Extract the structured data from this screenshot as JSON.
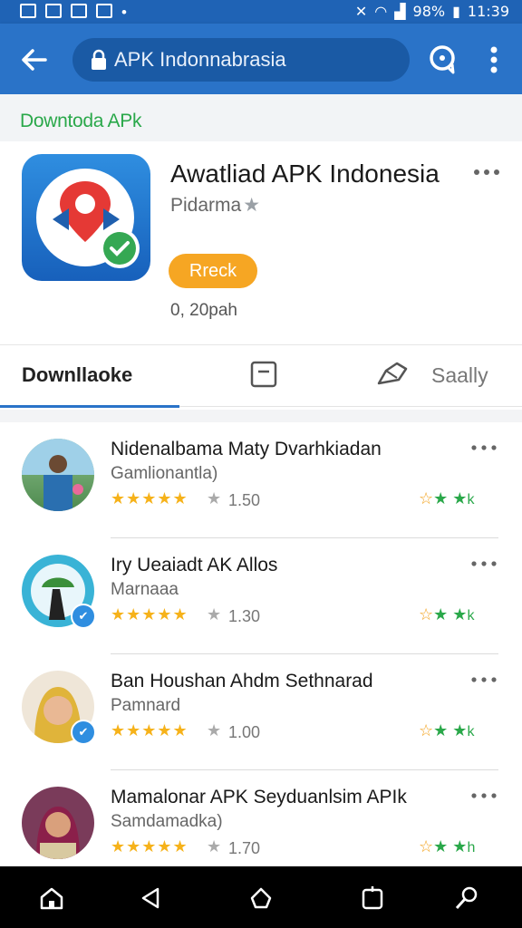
{
  "status_bar": {
    "battery_percent": "98%",
    "time": "11:39"
  },
  "toolbar": {
    "url_text": "APK Indonnabrasia"
  },
  "section": {
    "title": "Downtoda APk"
  },
  "app": {
    "title": "Awatliad APK Indonesia",
    "developer": "Pidarma",
    "install_label": "Rreck",
    "size": "0, 20pah"
  },
  "tabs": {
    "active_label": "Downllaoke",
    "right_label": "Saally"
  },
  "items": [
    {
      "title": "Nidenalbama Maty Dvarhkiadan",
      "subtitle": "Gamlionantla)",
      "rating_count": "1.50",
      "tag": "k"
    },
    {
      "title": "Iry Ueaiadt AK Allos",
      "subtitle": "Marnaaa",
      "rating_count": "1.30",
      "tag": "k"
    },
    {
      "title": "Ban Houshan Ahdm Sethnarad",
      "subtitle": "Pamnard",
      "rating_count": "1.00",
      "tag": "k"
    },
    {
      "title": "Mamalonar APK Seyduanlsim APIk",
      "subtitle": "Samdamadka)",
      "rating_count": "1.70",
      "tag": "h"
    }
  ],
  "colors": {
    "primary": "#2a73c8",
    "accent_orange": "#f6a623",
    "green": "#2aa84a"
  }
}
